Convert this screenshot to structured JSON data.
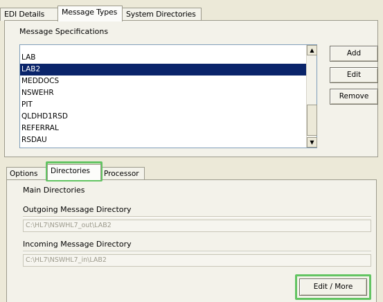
{
  "top_tabs": [
    {
      "label": "EDI Details",
      "active": false
    },
    {
      "label": "Message Types",
      "active": true
    },
    {
      "label": "System Directories",
      "active": false
    }
  ],
  "message_specifications": {
    "title": "Message Specifications",
    "items": [
      "LAB",
      "LAB2",
      "MEDDOCS",
      "NSWEHR",
      "PIT",
      "QLDHD1RSD",
      "REFERRAL",
      "RSDAU"
    ],
    "selected_item": "LAB2"
  },
  "spec_buttons": {
    "add": "Add",
    "edit": "Edit",
    "remove": "Remove"
  },
  "lower_tabs": [
    {
      "label": "Options",
      "active": false
    },
    {
      "label": "Directories",
      "active": true
    },
    {
      "label": "Processor",
      "active": false
    }
  ],
  "directories": {
    "group_title": "Main Directories",
    "outgoing_label": "Outgoing Message Directory",
    "outgoing_value": "C:\\HL7\\NSWHL7_out\\LAB2",
    "incoming_label": "Incoming Message Directory",
    "incoming_value": "C:\\HL7\\NSWHL7_in\\LAB2",
    "edit_more_button": "Edit / More"
  },
  "highlight_color": "#62c462",
  "selection_color": "#0a246a"
}
